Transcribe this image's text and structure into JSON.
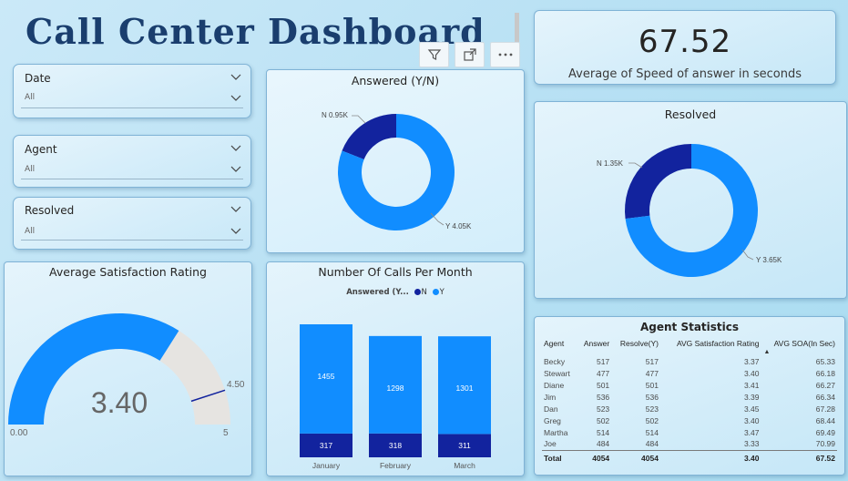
{
  "header": {
    "title": "Call Center Dashboard"
  },
  "colors": {
    "navy": "#1a3e6e",
    "dark_blue": "#12239e",
    "blue": "#118dff",
    "gauge_bg": "#e6e4e1"
  },
  "filters": [
    {
      "label": "Date",
      "value": "All"
    },
    {
      "label": "Agent",
      "value": "All"
    },
    {
      "label": "Resolved",
      "value": "All"
    }
  ],
  "kpi": {
    "value": "67.52",
    "label": "Average of Speed of answer in seconds"
  },
  "answered_chart": {
    "title": "Answered (Y/N)",
    "labels": {
      "n": "N 0.95K",
      "y": "Y 4.05K"
    },
    "chart_data": {
      "type": "pie",
      "categories": [
        "N",
        "Y"
      ],
      "values": [
        950,
        4050
      ]
    }
  },
  "resolved_chart": {
    "title": "Resolved",
    "labels": {
      "n": "N 1.35K",
      "y": "Y 3.65K"
    },
    "chart_data": {
      "type": "pie",
      "categories": [
        "N",
        "Y"
      ],
      "values": [
        1350,
        3650
      ]
    }
  },
  "gauge": {
    "title": "Average Satisfaction Rating",
    "value_text": "3.40",
    "min_text": "0.00",
    "max_text": "5",
    "target_text": "4.50",
    "chart_data": {
      "type": "gauge",
      "value": 3.4,
      "min": 0,
      "max": 5,
      "target": 4.5
    }
  },
  "calls_chart": {
    "title": "Number Of Calls Per Month",
    "legend_title": "Answered (Y...",
    "legend_items": [
      "N",
      "Y"
    ],
    "chart_data": {
      "type": "bar",
      "stacked": true,
      "categories": [
        "January",
        "February",
        "March"
      ],
      "series": [
        {
          "name": "N",
          "values": [
            317,
            318,
            311
          ]
        },
        {
          "name": "Y",
          "values": [
            1455,
            1298,
            1301
          ]
        }
      ]
    }
  },
  "agent_table": {
    "title": "Agent Statistics",
    "columns": [
      "Agent",
      "Answer",
      "Resolve(Y)",
      "AVG Satisfaction Rating",
      "AVG SOA(In Sec)"
    ],
    "rows": [
      [
        "Becky",
        "517",
        "517",
        "3.37",
        "65.33"
      ],
      [
        "Stewart",
        "477",
        "477",
        "3.40",
        "66.18"
      ],
      [
        "Diane",
        "501",
        "501",
        "3.41",
        "66.27"
      ],
      [
        "Jim",
        "536",
        "536",
        "3.39",
        "66.34"
      ],
      [
        "Dan",
        "523",
        "523",
        "3.45",
        "67.28"
      ],
      [
        "Greg",
        "502",
        "502",
        "3.40",
        "68.44"
      ],
      [
        "Martha",
        "514",
        "514",
        "3.47",
        "69.49"
      ],
      [
        "Joe",
        "484",
        "484",
        "3.33",
        "70.99"
      ]
    ],
    "total": [
      "Total",
      "4054",
      "4054",
      "3.40",
      "67.52"
    ]
  }
}
